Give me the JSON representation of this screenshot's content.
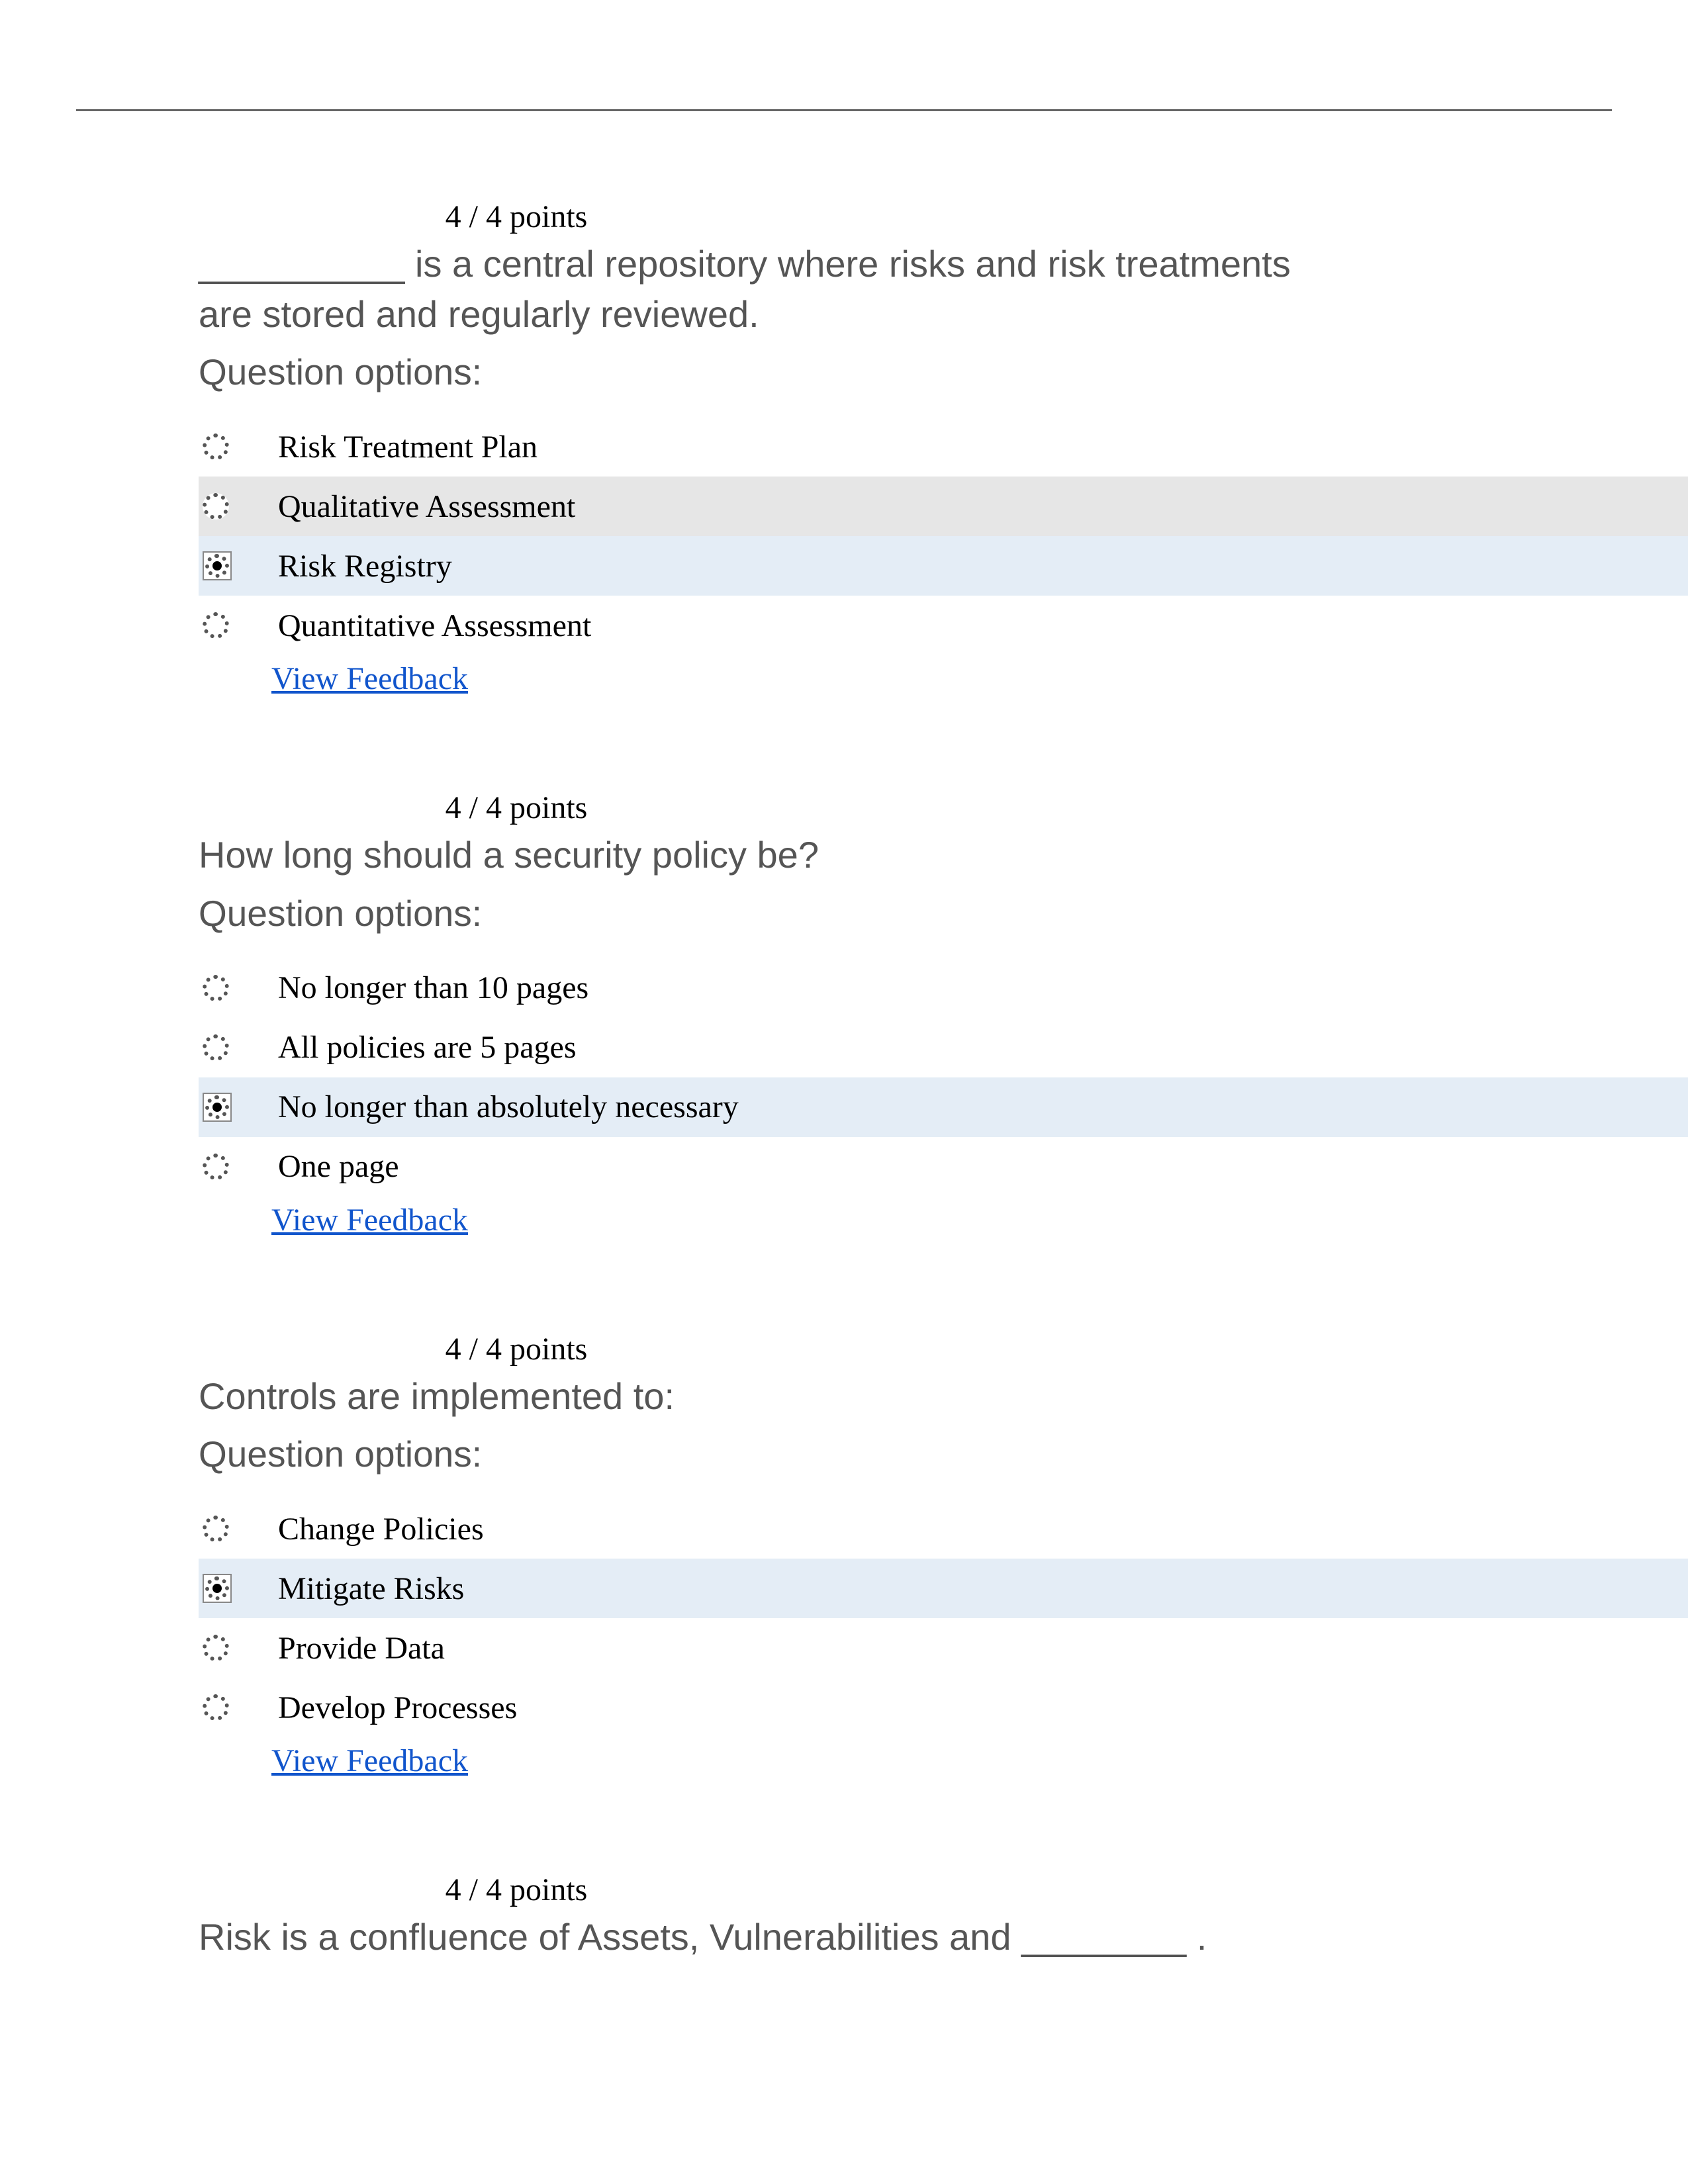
{
  "labels": {
    "options_heading": "Question options:",
    "feedback": "View Feedback"
  },
  "questions": [
    {
      "points": "4 / 4 points",
      "text": "__________ is a central repository where risks and risk treatments are stored and regularly reviewed.",
      "options": [
        {
          "label": "Risk Treatment Plan",
          "selected": false,
          "alt": false
        },
        {
          "label": "Qualitative Assessment",
          "selected": false,
          "alt": true
        },
        {
          "label": "Risk Registry",
          "selected": true,
          "alt": false
        },
        {
          "label": "Quantitative Assessment",
          "selected": false,
          "alt": false
        }
      ],
      "show_feedback": true,
      "show_options": true
    },
    {
      "points": "4 / 4 points",
      "text": "How long should a security policy be?",
      "options": [
        {
          "label": "No longer than 10 pages",
          "selected": false,
          "alt": false
        },
        {
          "label": "All policies are 5 pages",
          "selected": false,
          "alt": false
        },
        {
          "label": "No longer than absolutely necessary",
          "selected": true,
          "alt": false
        },
        {
          "label": "One page",
          "selected": false,
          "alt": false
        }
      ],
      "show_feedback": true,
      "show_options": true
    },
    {
      "points": "4 / 4 points",
      "text": "Controls are implemented to:",
      "options": [
        {
          "label": "Change Policies",
          "selected": false,
          "alt": false
        },
        {
          "label": "Mitigate Risks",
          "selected": true,
          "alt": false
        },
        {
          "label": "Provide Data",
          "selected": false,
          "alt": false
        },
        {
          "label": "Develop Processes",
          "selected": false,
          "alt": false
        }
      ],
      "show_feedback": true,
      "show_options": true
    },
    {
      "points": "4 / 4 points",
      "text": "Risk is a confluence of Assets, Vulnerabilities and ________ .",
      "options": [],
      "show_feedback": false,
      "show_options": false
    }
  ]
}
